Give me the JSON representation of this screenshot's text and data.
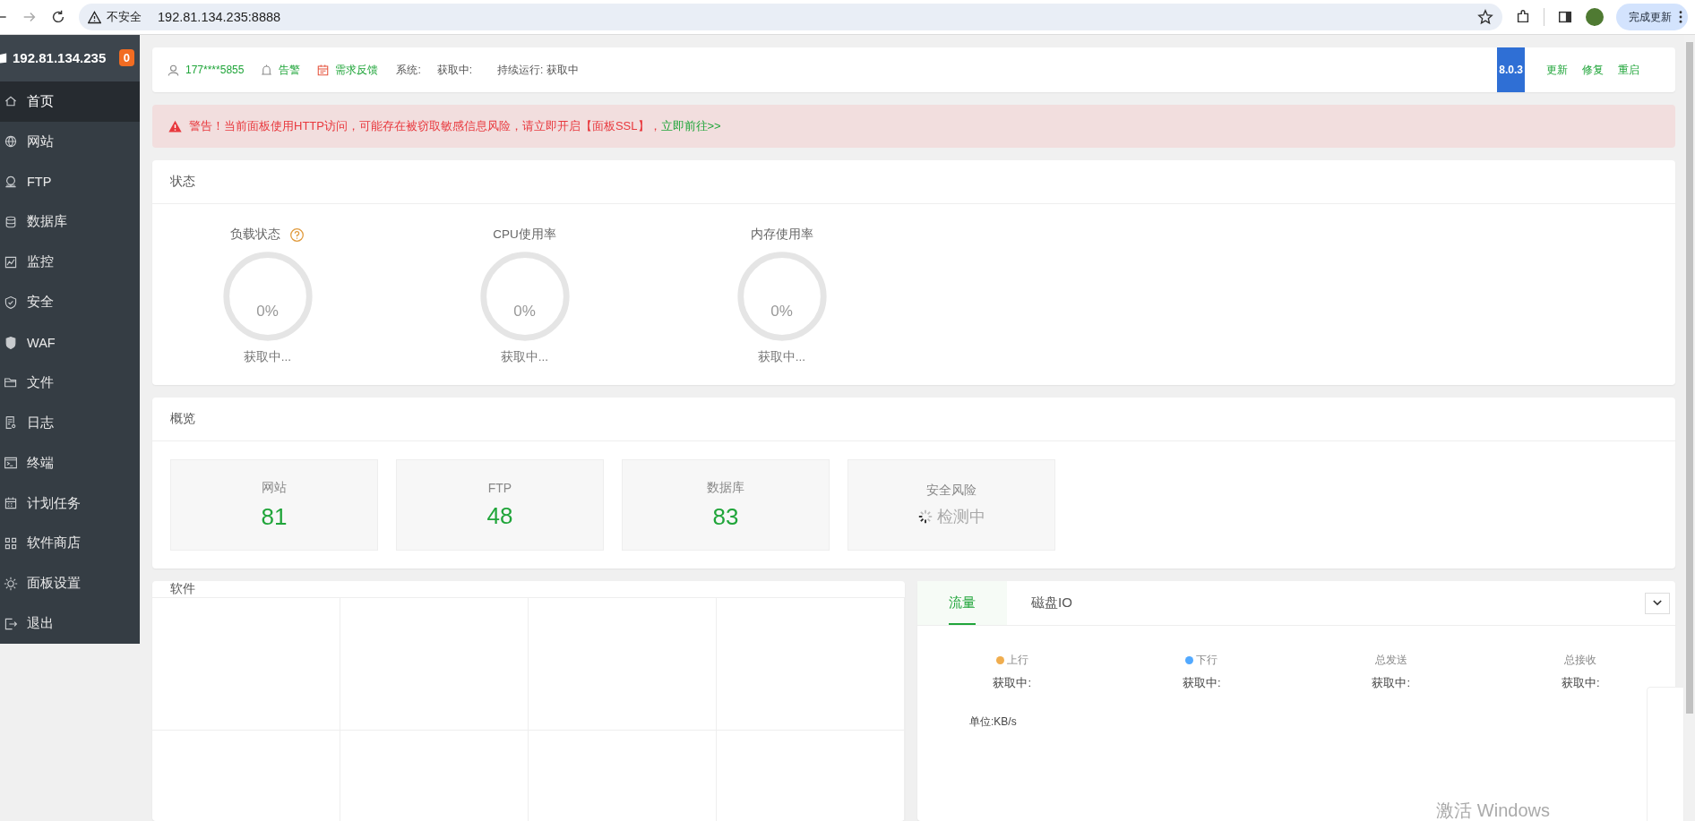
{
  "browser": {
    "security_label": "不安全",
    "url": "192.81.134.235:8888",
    "update_button": "完成更新"
  },
  "sidebar": {
    "title": "192.81.134.235",
    "badge": "0",
    "items": [
      {
        "label": "首页",
        "selected": true
      },
      {
        "label": "网站",
        "selected": false
      },
      {
        "label": "FTP",
        "selected": false
      },
      {
        "label": "数据库",
        "selected": false
      },
      {
        "label": "监控",
        "selected": false
      },
      {
        "label": "安全",
        "selected": false
      },
      {
        "label": "WAF",
        "selected": false
      },
      {
        "label": "文件",
        "selected": false
      },
      {
        "label": "日志",
        "selected": false
      },
      {
        "label": "终端",
        "selected": false
      },
      {
        "label": "计划任务",
        "selected": false
      },
      {
        "label": "软件商店",
        "selected": false
      },
      {
        "label": "面板设置",
        "selected": false
      },
      {
        "label": "退出",
        "selected": false
      }
    ]
  },
  "info_bar": {
    "user": "177****5855",
    "alarm": "告警",
    "feedback": "需求反馈",
    "system_label": "系统:",
    "system_value": "获取中:",
    "uptime": "持续运行: 获取中",
    "version": "8.0.3",
    "actions": [
      "更新",
      "修复",
      "重启"
    ]
  },
  "warning": {
    "text": "警告！当前面板使用HTTP访问，可能存在被窃取敏感信息风险，请立即开启【面板SSL】，",
    "link": "立即前往>>"
  },
  "status": {
    "title": "状态",
    "gauges": [
      {
        "label": "负载状态",
        "help": true,
        "value": "0%",
        "caption": "获取中..."
      },
      {
        "label": "CPU使用率",
        "help": false,
        "value": "0%",
        "caption": "获取中..."
      },
      {
        "label": "内存使用率",
        "help": false,
        "value": "0%",
        "caption": "获取中..."
      }
    ]
  },
  "overview": {
    "title": "概览",
    "cards": [
      {
        "label": "网站",
        "value": "81",
        "kind": "count"
      },
      {
        "label": "FTP",
        "value": "48",
        "kind": "count"
      },
      {
        "label": "数据库",
        "value": "83",
        "kind": "count"
      },
      {
        "label": "安全风险",
        "value": "检测中",
        "kind": "loading"
      }
    ]
  },
  "software": {
    "title": "软件"
  },
  "traffic": {
    "tabs": [
      {
        "label": "流量",
        "selected": true
      },
      {
        "label": "磁盘IO",
        "selected": false
      }
    ],
    "stats": [
      {
        "label": "上行",
        "color": "#f0ad4e",
        "value": "获取中:"
      },
      {
        "label": "下行",
        "color": "#52a9ff",
        "value": "获取中:"
      },
      {
        "label": "总发送",
        "value": "获取中:"
      },
      {
        "label": "总接收",
        "value": "获取中:"
      }
    ],
    "unit": "单位:KB/s"
  },
  "os_notice": "激活 Windows"
}
